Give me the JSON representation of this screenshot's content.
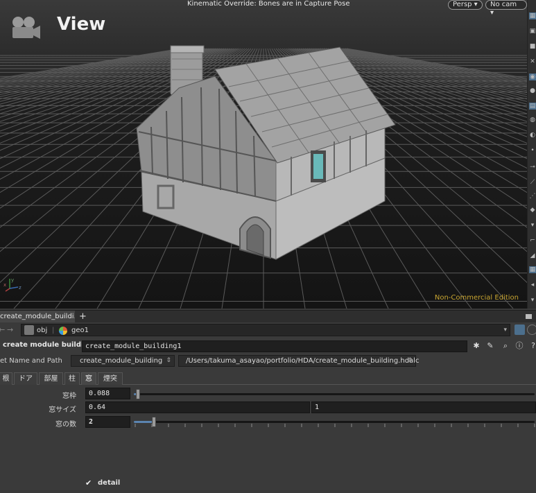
{
  "viewport": {
    "title": "View",
    "status_message": "Kinematic Override: Bones are in Capture Pose",
    "camera_mode": "Persp",
    "camera": "No cam",
    "edition": "Non-Commercial Edition",
    "axis_x": "x",
    "axis_y": "y",
    "axis_z": "z"
  },
  "tab": {
    "label": "create_module_buildi...",
    "close": "•",
    "add": "+"
  },
  "path": {
    "back": "←",
    "forward": "→",
    "segments": [
      "obj",
      "geo1"
    ],
    "dropdown": "▾"
  },
  "node": {
    "type_label": "create module building",
    "name": "create_module_building1"
  },
  "asset": {
    "label": "et Name and Path",
    "name": "create_module_building",
    "path": "/Users/takuma_asayao/portfolio/HDA/create_module_building.hdalc"
  },
  "folders": [
    "根",
    "ドア",
    "部屋",
    "柱",
    "窓",
    "煙突"
  ],
  "active_folder": "窓",
  "params": {
    "frame": {
      "label": "窓枠",
      "value": "0.088",
      "slider": 0.01
    },
    "size": {
      "label": "窓サイズ",
      "value_x": "0.64",
      "value_y": "1"
    },
    "count": {
      "label": "窓の数",
      "value": "2",
      "slider": 0.05
    },
    "detail": {
      "label": "detail",
      "checked": true
    }
  },
  "colors": {
    "accent": "#5b84b0",
    "edition": "#c8a531",
    "window_glass": "#69b9b9"
  }
}
